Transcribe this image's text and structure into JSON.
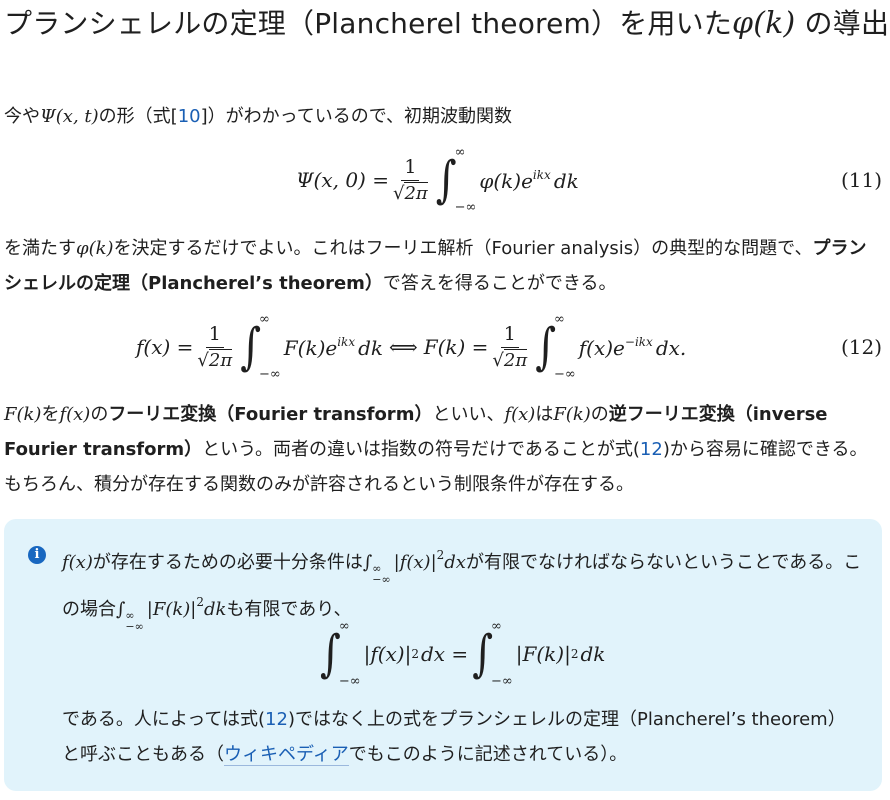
{
  "title": {
    "text": "プランシェレルの定理（Plancherel theorem）を用いた",
    "math": "φ(k)",
    "suffix": "の導出"
  },
  "para1": {
    "prefix": "今や",
    "math1": "Ψ(x, t)",
    "text1": "の形（式[",
    "ref": "10",
    "text2": "]）がわかっているので、初期波動関数"
  },
  "eq11": {
    "lhs": "Ψ(x, 0) =",
    "num": "1",
    "den": "2π",
    "int_upper": "∞",
    "int_lower": "−∞",
    "integrand": "φ(k)e",
    "exp": "ikx",
    "dk": "dk",
    "number": "(11)"
  },
  "para2": {
    "prefix": "を満たす",
    "math1": "φ(k)",
    "text1": "を決定するだけでよい。これはフーリエ解析（Fourier analysis）の典型的な問題で、",
    "bold": "プランシェレルの定理（Plancherel’s theorem）",
    "text2": "で答えを得ることができる。"
  },
  "eq12": {
    "lhs": "f(x) =",
    "num": "1",
    "den": "2π",
    "int_upper": "∞",
    "int_lower": "−∞",
    "integrand1": "F(k)e",
    "exp1": "ikx",
    "dk": "dk",
    "iff": "⟺",
    "mid": "F(k) =",
    "integrand2": "f(x)e",
    "exp2": "−ikx",
    "dx": "dx.",
    "number": "(12)"
  },
  "para3": {
    "m1": "F(k)",
    "t1": "を",
    "m2": "f(x)",
    "t2": "の",
    "b1": "フーリエ変換（Fourier transform）",
    "t3": "といい、",
    "m3": "f(x)",
    "t4": "は",
    "m4": "F(k)",
    "t5": "の",
    "b2": "逆フーリエ変換（inverse Fourier transform）",
    "t6": "という。両者の違いは指数の符号だけであることが式(",
    "ref": "12",
    "t7": ")から容易に確認できる。もちろん、積分が存在する関数のみが許容されるという制限条件が存在する。"
  },
  "info": {
    "icon": "i",
    "line1_m1": "f(x)",
    "line1_t1": "が存在するための必要十分条件は",
    "line1_int": "∫",
    "line1_lim_up": "∞",
    "line1_lim_lo": "−∞",
    "line1_m2": "|f(x)|",
    "line1_sq": "2",
    "line1_m3": "dx",
    "line1_t2": "が有限でなければならないということである。この場合",
    "line2_m1": "|F(k)|",
    "line2_m2": "dk",
    "line2_t1": "も有限であり、",
    "eq_left": "|f(x)|",
    "eq_dx": "dx =",
    "eq_right": "|F(k)|",
    "eq_dk": "dk",
    "text3a": "である。人によっては式(",
    "ref": "12",
    "text3b": ")ではなく上の式をプランシェレルの定理（Plancherel’s theorem）と呼ぶこともある（",
    "link": "ウィキペディア",
    "text3c": "でもこのように記述されている）。"
  }
}
